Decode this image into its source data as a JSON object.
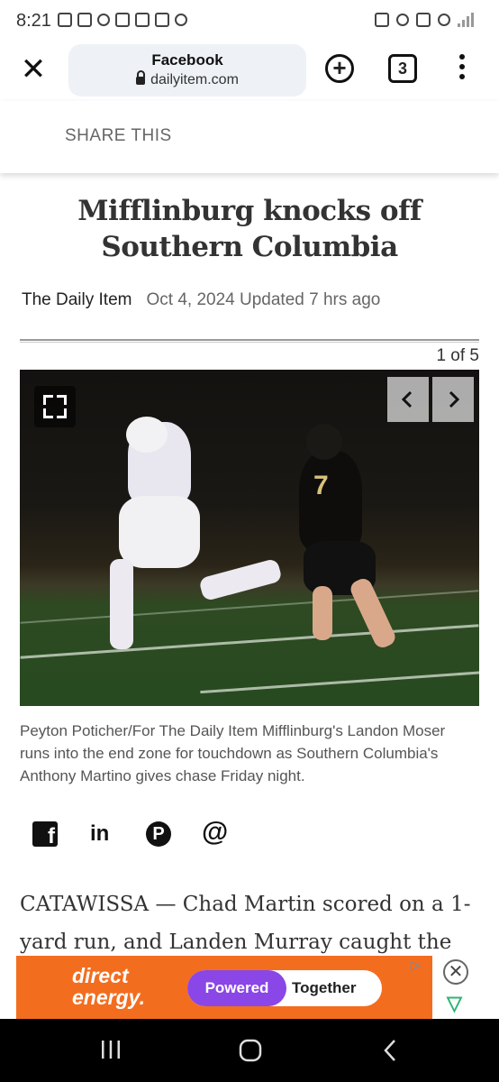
{
  "status_bar": {
    "time": "8:21"
  },
  "browser": {
    "page_title": "Facebook",
    "url": "dailyitem.com",
    "tab_count": "3",
    "new_tab_symbol": "+",
    "close_symbol": "✕"
  },
  "share_bar": {
    "label": "SHARE THIS"
  },
  "article": {
    "headline": "Mifflinburg knocks off Southern Columbia",
    "source": "The Daily Item",
    "date": "Oct 4, 2024 Updated 7 hrs ago",
    "photo_counter": "1 of 5",
    "caption": "Peyton Poticher/For The Daily Item Mifflinburg's Landon Moser runs into the end zone for touchdown as Southern Columbia's Anthony Martino gives chase Friday night.",
    "body_start": "CATAWISSA — Chad Martin scored on a 1-yard run, and Landen Murray caught the go-"
  },
  "social": {
    "facebook_glyph": "f",
    "linkedin_glyph": "in",
    "pinterest_glyph": "P",
    "email_glyph": "@"
  },
  "ad": {
    "brand_line1": "direct",
    "brand_line2": "energy.",
    "pill_left": "Powered",
    "pill_right": "Together"
  },
  "photo": {
    "jersey_number": "7"
  }
}
